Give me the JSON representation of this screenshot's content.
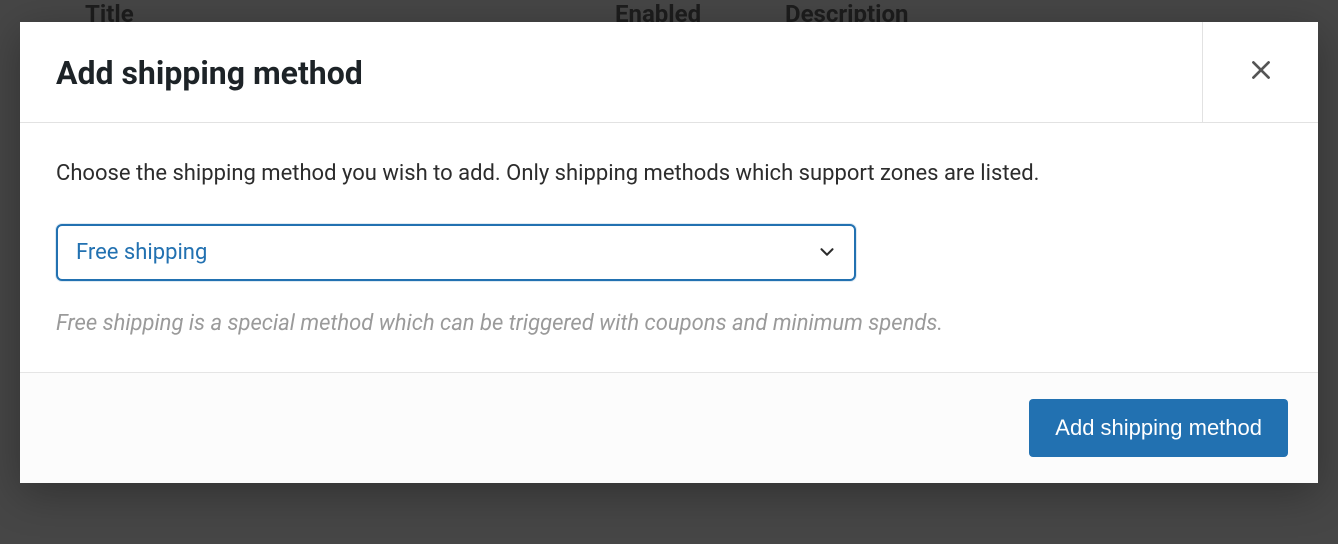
{
  "backdrop": {
    "columns": {
      "title": "Title",
      "enabled": "Enabled",
      "description": "Description"
    }
  },
  "modal": {
    "title": "Add shipping method",
    "instruction": "Choose the shipping method you wish to add. Only shipping methods which support zones are listed.",
    "select": {
      "selected_label": "Free shipping",
      "help_text": "Free shipping is a special method which can be triggered with coupons and minimum spends."
    },
    "footer": {
      "submit_label": "Add shipping method"
    }
  }
}
